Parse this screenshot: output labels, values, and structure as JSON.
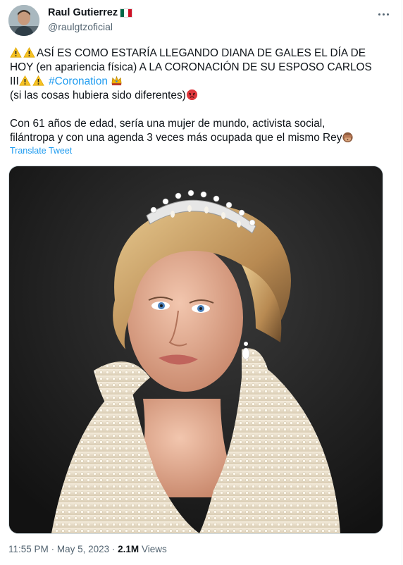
{
  "tweet": {
    "author": {
      "display_name": "Raul Gutierrez",
      "handle": "@raulgtzoficial",
      "flag_emoji": "mexico-flag",
      "avatar": "avatar-photo"
    },
    "text": {
      "line1_part1": "ASÍ ES COMO ESTARÍA LLEGANDO DIANA DE GALES EL DÍA DE",
      "line2": "HOY (en apariencia física) A LA CORONACIÓN DE SU ESPOSO CARLOS",
      "line3_prefix": "III",
      "hashtag": "#Coronation",
      "line4": "(si las cosas hubiera sido diferentes)",
      "para2_line1": "Con 61 años de edad, sería una mujer de mundo, activista social,",
      "para2_line2": "filántropa y con una agenda 3 veces más ocupada que el mismo Rey"
    },
    "emojis": [
      "warning",
      "warning",
      "warning",
      "warning",
      "crown",
      "angry-face",
      "see-no-evil-monkey"
    ],
    "translate_label": "Translate Tweet",
    "image_description_icon": "portrait-photo",
    "time": "11:55 PM",
    "separator": "·",
    "date": "May 5, 2023",
    "views_count": "2.1M",
    "views_label": "Views"
  },
  "colors": {
    "link": "#1d9bf0",
    "secondary_text": "#536471",
    "primary_text": "#0f1419"
  }
}
